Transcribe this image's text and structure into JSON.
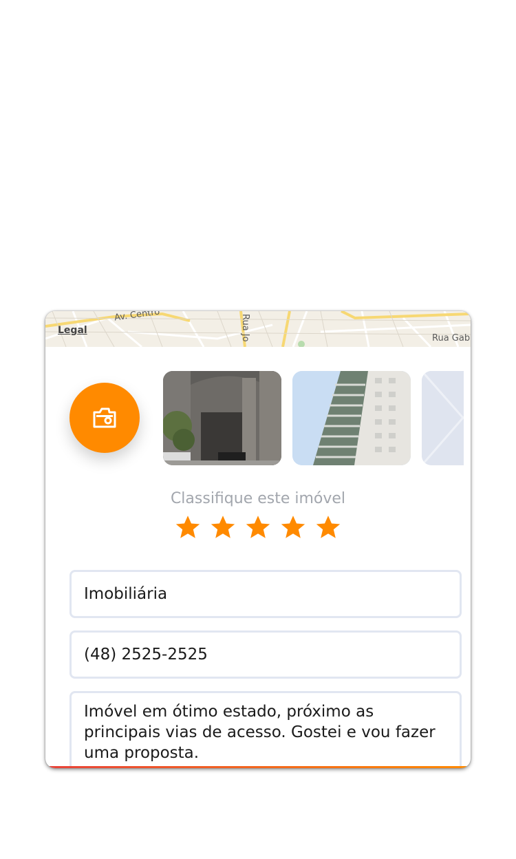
{
  "map": {
    "legal_label": "Legal",
    "road_labels": [
      "Av. Centro",
      "Rua Jo",
      "Rua Gab"
    ]
  },
  "camera_button": {
    "icon": "camera-icon"
  },
  "gallery": {
    "photos": [
      {
        "description_icon": "building-photo"
      },
      {
        "description_icon": "building-photo"
      },
      {
        "description_icon": "image-placeholder-icon"
      }
    ]
  },
  "rating": {
    "label": "Classifique este imóvel",
    "value": 5,
    "max": 5,
    "star_color": "#ff8a00"
  },
  "form": {
    "agency": "Imobiliária",
    "phone": "(48) 2525-2525",
    "comment": "Imóvel em ótimo estado, próximo as principais vias de acesso. Gostei e vou fazer uma proposta."
  },
  "colors": {
    "accent": "#ff8a00",
    "field_border": "#e1e6f1",
    "muted_text": "#a2a6ad"
  }
}
